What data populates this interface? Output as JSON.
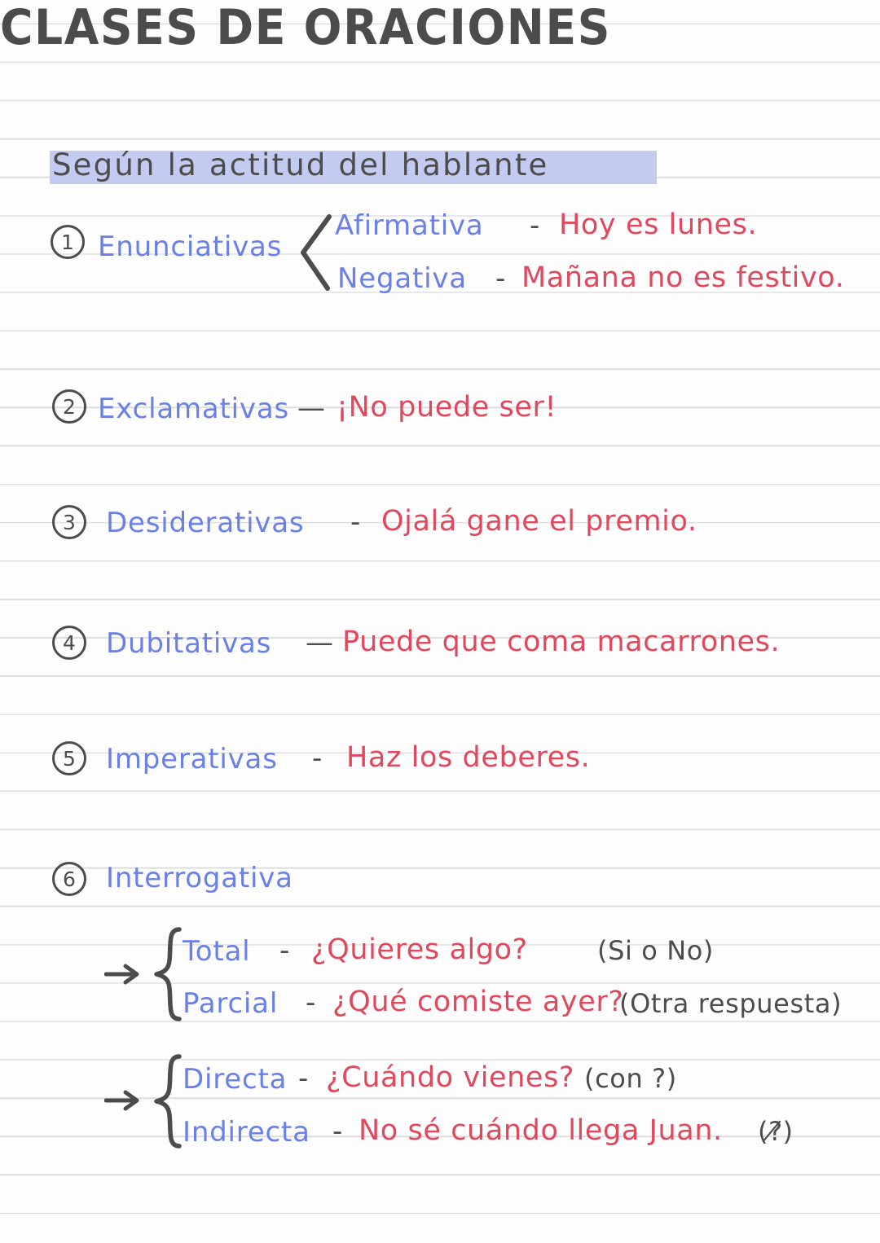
{
  "page": {
    "title": "CLASES DE ORACIONES",
    "subtitle": "Según la actitud del hablante",
    "colors": {
      "heading": "#4c4c4c",
      "term": "#6b7fe8",
      "example": "#e0485d",
      "highlight": "#c3cbf0",
      "rule_line": "#dcdcdc",
      "paper": "#fdfdfd"
    }
  },
  "entries": [
    {
      "number": "1",
      "label": "Enunciativas",
      "bracket": "angle",
      "subentries": [
        {
          "label": "Afirmativa",
          "dash": "-",
          "example": "Hoy es lunes."
        },
        {
          "label": "Negativa",
          "dash": "-",
          "example": "Mañana no es festivo."
        }
      ]
    },
    {
      "number": "2",
      "label": "Exclamativas",
      "dash": "—",
      "example": "¡No puede ser!"
    },
    {
      "number": "3",
      "label": "Desiderativas",
      "dash": "-",
      "example": "Ojalá gane el premio."
    },
    {
      "number": "4",
      "label": "Dubitativas",
      "dash": "—",
      "example": "Puede que coma macarrones."
    },
    {
      "number": "5",
      "label": "Imperativas",
      "dash": "-",
      "example": "Haz los deberes."
    },
    {
      "number": "6",
      "label": "Interrogativa",
      "groups": [
        {
          "arrow": "→",
          "rows": [
            {
              "label": "Total",
              "dash": "-",
              "example": "¿Quieres algo?",
              "note": "(Si o No)"
            },
            {
              "label": "Parcial",
              "dash": "-",
              "example": "¿Qué comiste ayer?",
              "note": "(Otra respuesta)"
            }
          ]
        },
        {
          "arrow": "→",
          "rows": [
            {
              "label": "Directa",
              "dash": "-",
              "example": "¿Cuándo vienes?",
              "note": "(con ?)"
            },
            {
              "label": "Indirecta",
              "dash": "-",
              "example": "No sé cuándo llega Juan.",
              "note": "(?̸)"
            }
          ]
        }
      ]
    }
  ]
}
